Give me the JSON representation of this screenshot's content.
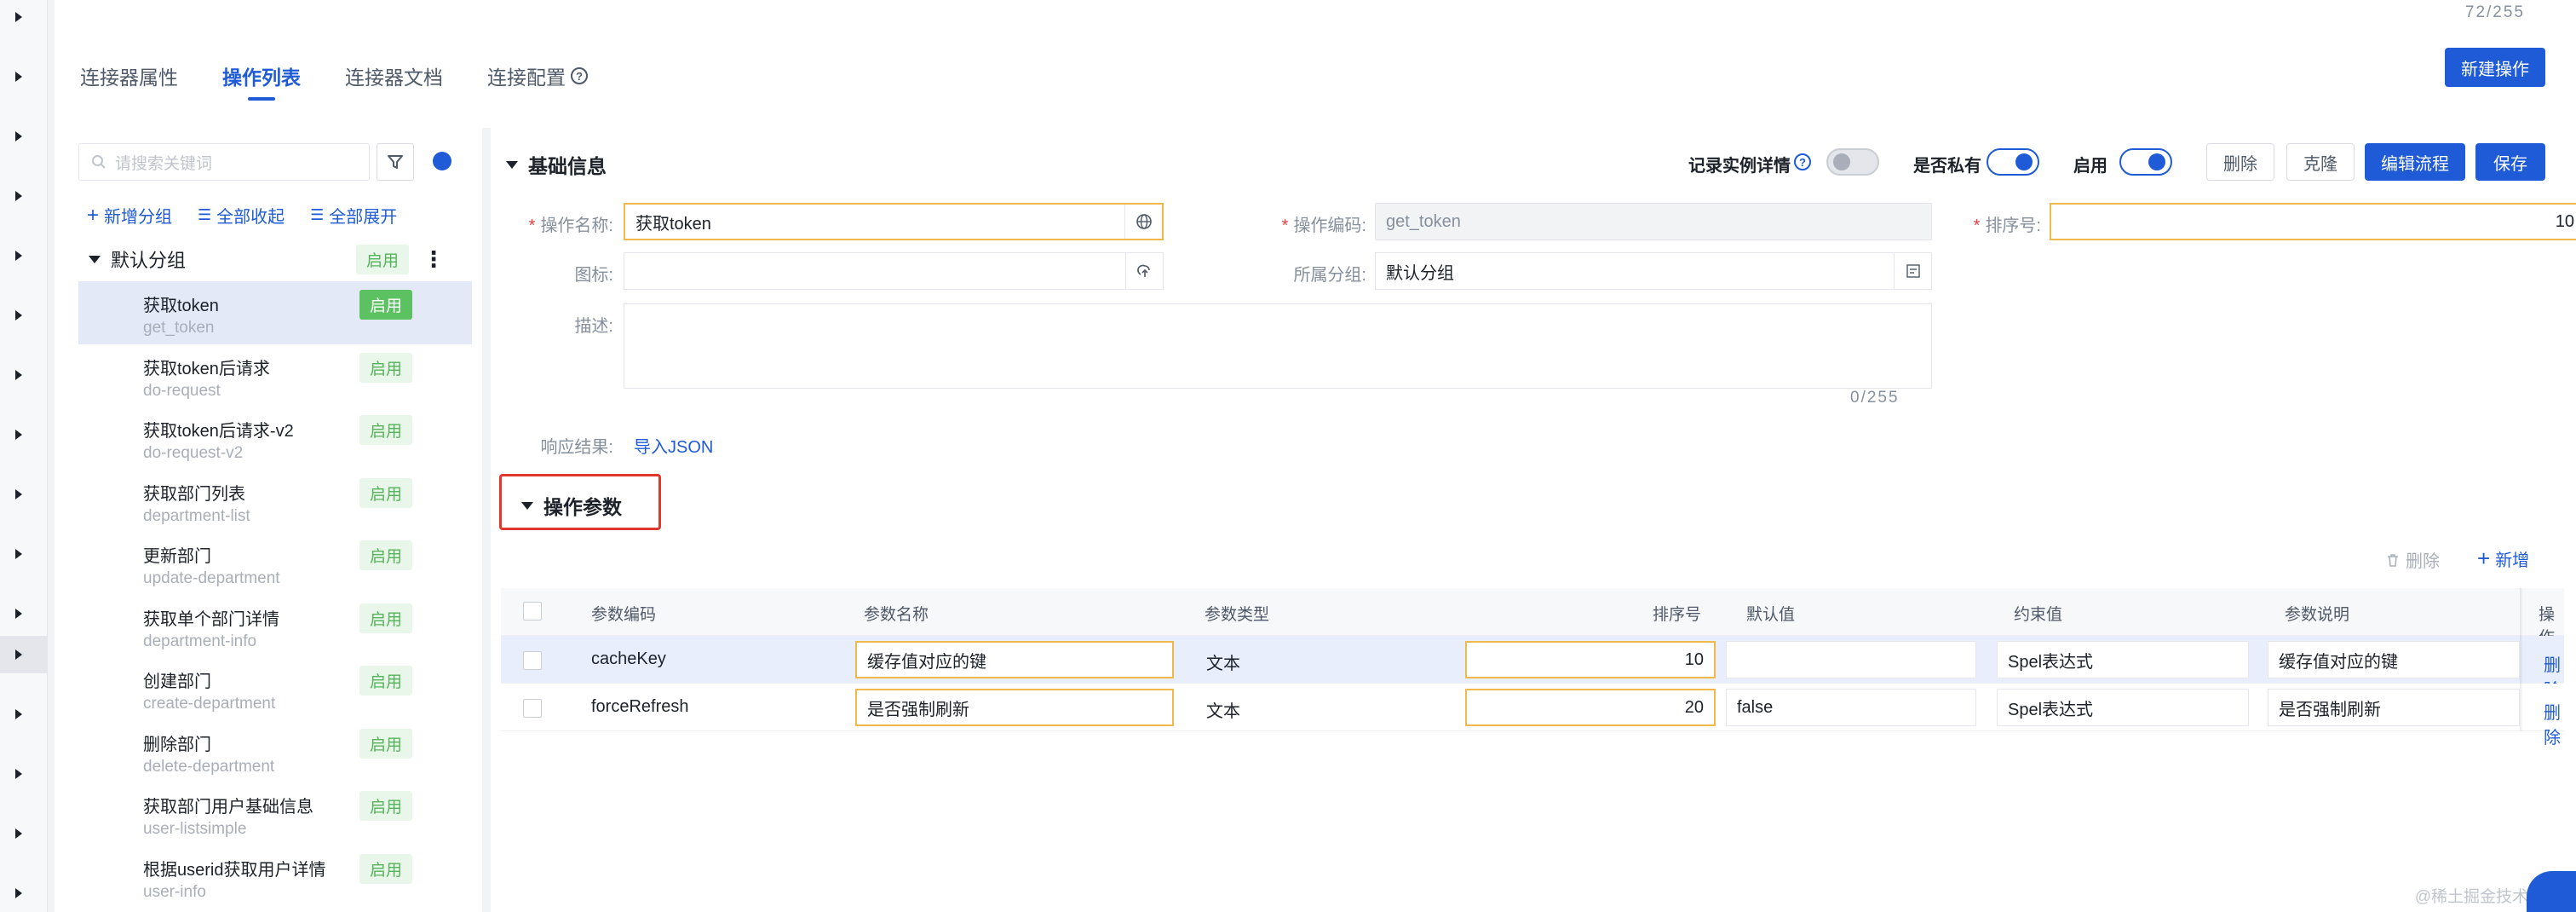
{
  "header": {
    "top_counter": "72/255",
    "tabs": [
      {
        "label": "连接器属性"
      },
      {
        "label": "操作列表"
      },
      {
        "label": "连接器文档"
      },
      {
        "label": "连接配置"
      }
    ],
    "new_op_label": "新建操作"
  },
  "sidebar": {
    "search_placeholder": "请搜索关键词",
    "actions": {
      "add_group": "新增分组",
      "collapse_all": "全部收起",
      "expand_all": "全部展开"
    },
    "group": {
      "name": "默认分组",
      "status": "启用"
    },
    "items": [
      {
        "name": "获取token",
        "code": "get_token",
        "status": "启用"
      },
      {
        "name": "获取token后请求",
        "code": "do-request",
        "status": "启用"
      },
      {
        "name": "获取token后请求-v2",
        "code": "do-request-v2",
        "status": "启用"
      },
      {
        "name": "获取部门列表",
        "code": "department-list",
        "status": "启用"
      },
      {
        "name": "更新部门",
        "code": "update-department",
        "status": "启用"
      },
      {
        "name": "获取单个部门详情",
        "code": "department-info",
        "status": "启用"
      },
      {
        "name": "创建部门",
        "code": "create-department",
        "status": "启用"
      },
      {
        "name": "删除部门",
        "code": "delete-department",
        "status": "启用"
      },
      {
        "name": "获取部门用户基础信息",
        "code": "user-listsimple",
        "status": "启用"
      },
      {
        "name": "根据userid获取用户详情",
        "code": "user-info",
        "status": "启用"
      }
    ]
  },
  "basic": {
    "title": "基础信息",
    "record_label": "记录实例详情",
    "private_label": "是否私有",
    "enable_label": "启用",
    "buttons": {
      "delete": "删除",
      "clone": "克隆",
      "edit_flow": "编辑流程",
      "save": "保存"
    },
    "fields": {
      "op_name_label": "操作名称:",
      "op_name_value": "获取token",
      "op_code_label": "操作编码:",
      "op_code_value": "get_token",
      "order_label": "排序号:",
      "order_value": "10",
      "icon_label": "图标:",
      "group_label": "所属分组:",
      "group_value": "默认分组",
      "desc_label": "描述:",
      "desc_counter": "0/255",
      "response_label": "响应结果:",
      "import_json": "导入JSON"
    }
  },
  "params": {
    "title": "操作参数",
    "delete_label": "删除",
    "add_label": "新增",
    "columns": [
      "参数编码",
      "参数名称",
      "参数类型",
      "排序号",
      "默认值",
      "约束值",
      "参数说明",
      "操作"
    ],
    "rows": [
      {
        "code": "cacheKey",
        "name": "缓存值对应的键",
        "type": "文本",
        "order": "10",
        "default": "",
        "constraint": "Spel表达式",
        "desc": "缓存值对应的键",
        "action": "删除"
      },
      {
        "code": "forceRefresh",
        "name": "是否强制刷新",
        "type": "文本",
        "order": "20",
        "default": "false",
        "constraint": "Spel表达式",
        "desc": "是否强制刷新",
        "action": "删除"
      }
    ]
  },
  "footer": {
    "watermark": "@稀土掘金技术"
  },
  "colors": {
    "accent": "#1f5bd6",
    "success": "#5cc160",
    "highlight_box": "#e0382f",
    "focus_border": "#f0b94a"
  }
}
